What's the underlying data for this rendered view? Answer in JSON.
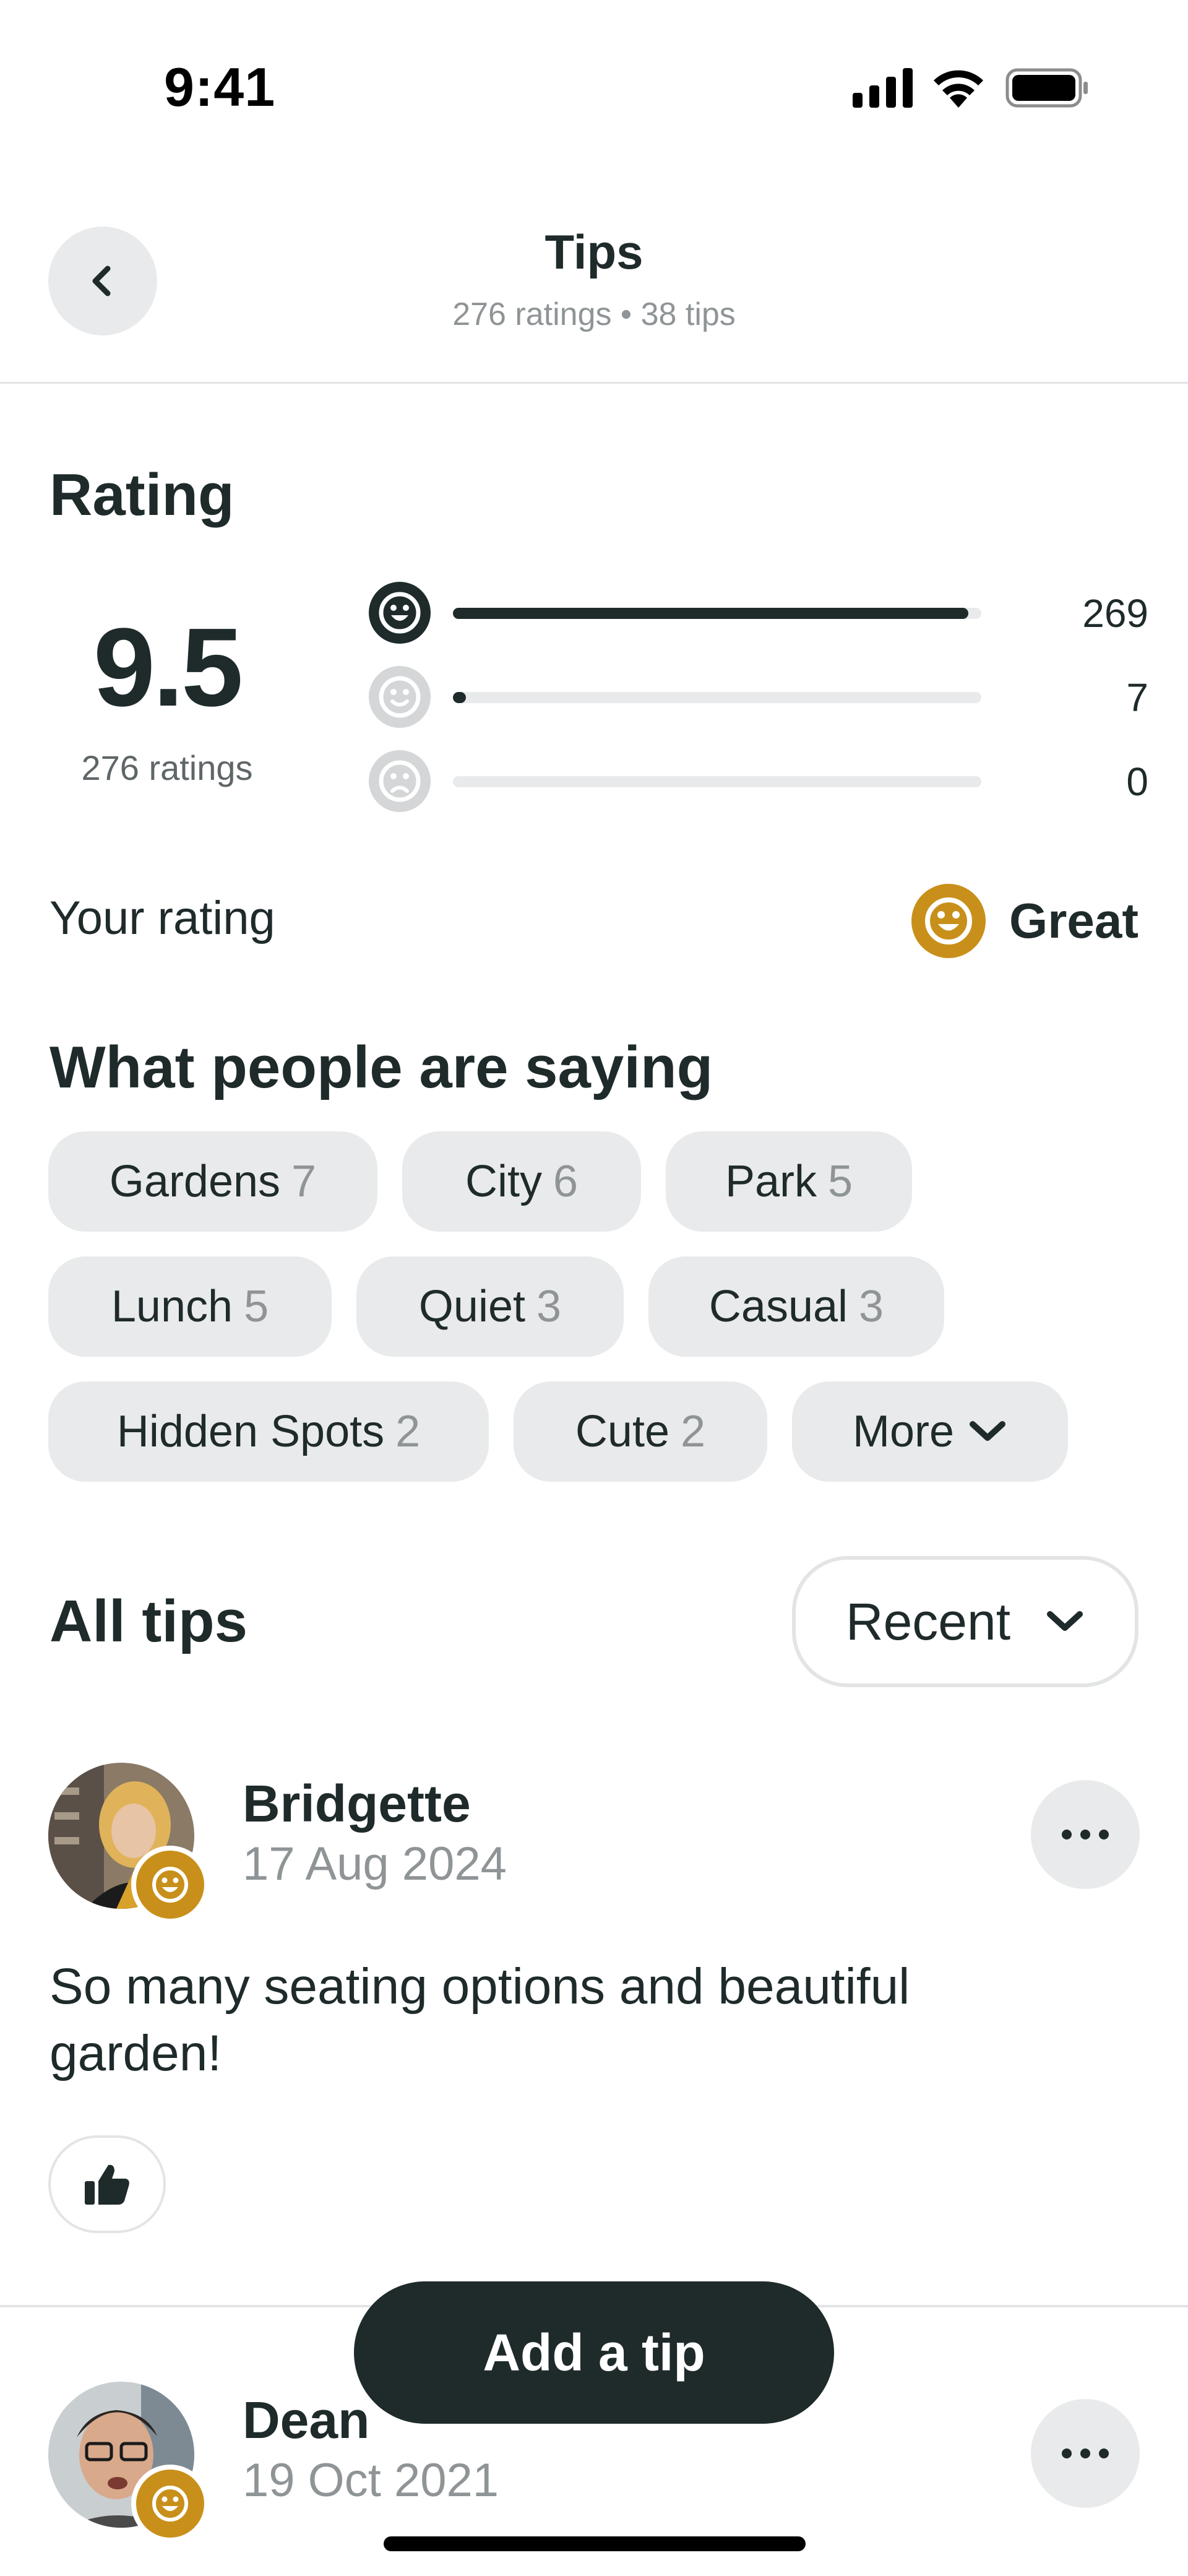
{
  "status_bar": {
    "time": "9:41"
  },
  "header": {
    "title": "Tips",
    "subtitle": "276 ratings • 38 tips",
    "back_icon": "chevron-left-icon"
  },
  "rating": {
    "title": "Rating",
    "score": "9.5",
    "score_sub": "276 ratings",
    "breakdown": [
      {
        "icon": "grin-face-icon",
        "count": "269",
        "fraction": 0.975
      },
      {
        "icon": "smile-face-icon",
        "count": "7",
        "fraction": 0.025
      },
      {
        "icon": "frown-face-icon",
        "count": "0",
        "fraction": 0
      }
    ],
    "your_rating_label": "Your rating",
    "your_rating_value": "Great"
  },
  "saying": {
    "title": "What people are saying",
    "chips": [
      {
        "label": "Gardens",
        "count": "7"
      },
      {
        "label": "City",
        "count": "6"
      },
      {
        "label": "Park",
        "count": "5"
      },
      {
        "label": "Lunch",
        "count": "5"
      },
      {
        "label": "Quiet",
        "count": "3"
      },
      {
        "label": "Casual",
        "count": "3"
      },
      {
        "label": "Hidden Spots",
        "count": "2"
      },
      {
        "label": "Cute",
        "count": "2"
      }
    ],
    "more_label": "More"
  },
  "all_tips": {
    "title": "All tips",
    "sort_label": "Recent",
    "tips": [
      {
        "name": "Bridgette",
        "date": "17 Aug 2024",
        "text": "So many seating options and beautiful garden!"
      },
      {
        "name": "Dean",
        "date": "19 Oct 2021"
      }
    ]
  },
  "add_tip_label": "Add a tip",
  "colors": {
    "primary": "#1f2a2b",
    "accent_gold": "#c8901a",
    "chip_bg": "#e9eaeb",
    "muted_text": "#8f9496"
  }
}
